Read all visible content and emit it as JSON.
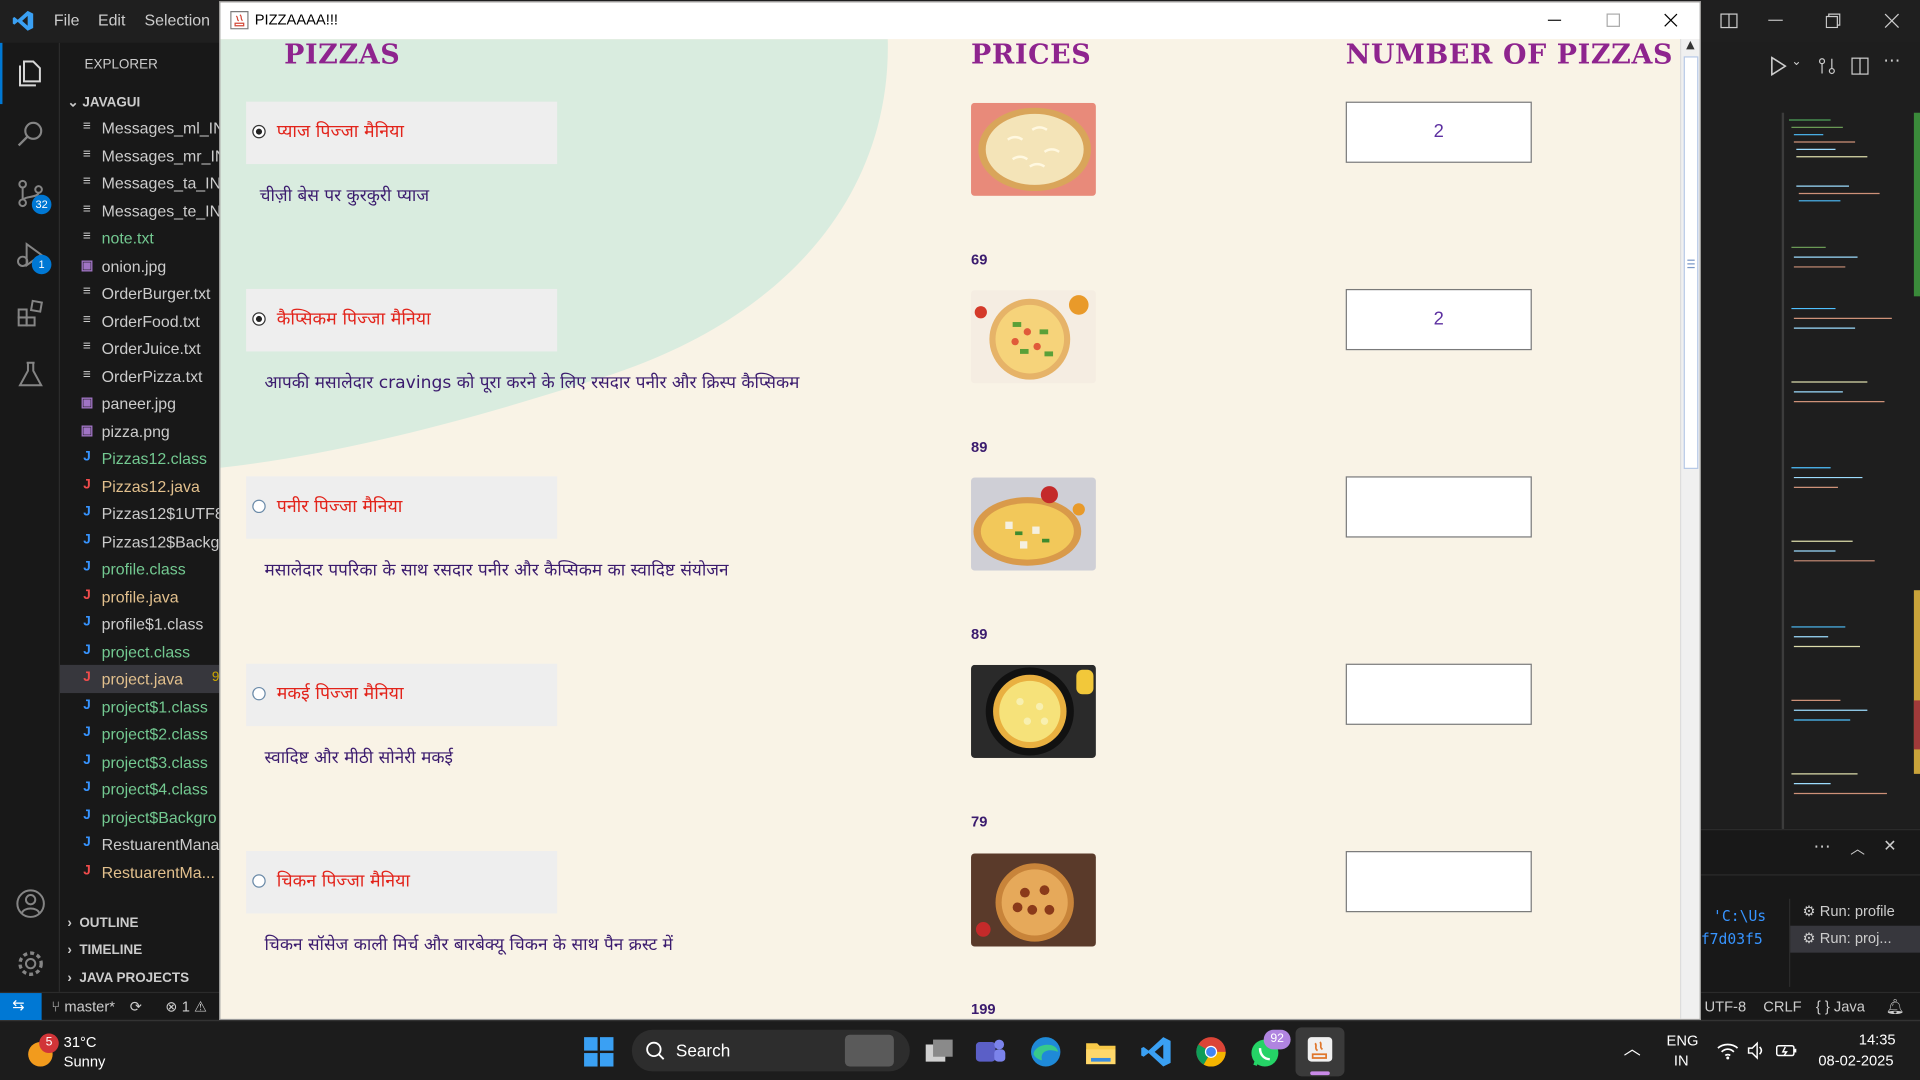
{
  "vscode": {
    "menu": [
      "File",
      "Edit",
      "Selection"
    ],
    "explorer_label": "EXPLORER",
    "folder_label": "JAVAGUI",
    "badges": {
      "source_control": "32",
      "run_debug": "1"
    },
    "files": [
      {
        "name": "Messages_ml_IN",
        "icon": "≡",
        "color": "#cccccc",
        "icon_color": "#cccccc"
      },
      {
        "name": "Messages_mr_IN",
        "icon": "≡",
        "color": "#cccccc",
        "icon_color": "#cccccc"
      },
      {
        "name": "Messages_ta_IN.",
        "icon": "≡",
        "color": "#cccccc",
        "icon_color": "#cccccc"
      },
      {
        "name": "Messages_te_IN.",
        "icon": "≡",
        "color": "#cccccc",
        "icon_color": "#cccccc"
      },
      {
        "name": "note.txt",
        "icon": "≡",
        "color": "#73c991",
        "icon_color": "#cccccc"
      },
      {
        "name": "onion.jpg",
        "icon": "▣",
        "color": "#cccccc",
        "icon_color": "#a074c4"
      },
      {
        "name": "OrderBurger.txt",
        "icon": "≡",
        "color": "#cccccc",
        "icon_color": "#cccccc"
      },
      {
        "name": "OrderFood.txt",
        "icon": "≡",
        "color": "#cccccc",
        "icon_color": "#cccccc"
      },
      {
        "name": "OrderJuice.txt",
        "icon": "≡",
        "color": "#cccccc",
        "icon_color": "#cccccc"
      },
      {
        "name": "OrderPizza.txt",
        "icon": "≡",
        "color": "#cccccc",
        "icon_color": "#cccccc"
      },
      {
        "name": "paneer.jpg",
        "icon": "▣",
        "color": "#cccccc",
        "icon_color": "#a074c4"
      },
      {
        "name": "pizza.png",
        "icon": "▣",
        "color": "#cccccc",
        "icon_color": "#a074c4"
      },
      {
        "name": "Pizzas12.class",
        "icon": "J",
        "color": "#73c991",
        "icon_color": "#3794ff"
      },
      {
        "name": "Pizzas12.java",
        "icon": "J",
        "color": "#e2c08d",
        "icon_color": "#f14c4c"
      },
      {
        "name": "Pizzas12$1UTF8",
        "icon": "J",
        "color": "#cccccc",
        "icon_color": "#3794ff"
      },
      {
        "name": "Pizzas12$Backgr",
        "icon": "J",
        "color": "#cccccc",
        "icon_color": "#3794ff"
      },
      {
        "name": "profile.class",
        "icon": "J",
        "color": "#73c991",
        "icon_color": "#3794ff"
      },
      {
        "name": "profile.java",
        "icon": "J",
        "color": "#e2c08d",
        "icon_color": "#f14c4c"
      },
      {
        "name": "profile$1.class",
        "icon": "J",
        "color": "#cccccc",
        "icon_color": "#3794ff"
      },
      {
        "name": "project.class",
        "icon": "J",
        "color": "#73c991",
        "icon_color": "#3794ff"
      },
      {
        "name": "project.java",
        "icon": "J",
        "color": "#e2c08d",
        "icon_color": "#f14c4c",
        "selected": true,
        "extra": "9"
      },
      {
        "name": "project$1.class",
        "icon": "J",
        "color": "#73c991",
        "icon_color": "#3794ff"
      },
      {
        "name": "project$2.class",
        "icon": "J",
        "color": "#73c991",
        "icon_color": "#3794ff"
      },
      {
        "name": "project$3.class",
        "icon": "J",
        "color": "#73c991",
        "icon_color": "#3794ff"
      },
      {
        "name": "project$4.class",
        "icon": "J",
        "color": "#73c991",
        "icon_color": "#3794ff"
      },
      {
        "name": "project$Backgro",
        "icon": "J",
        "color": "#73c991",
        "icon_color": "#3794ff"
      },
      {
        "name": "RestuarentMana",
        "icon": "J",
        "color": "#cccccc",
        "icon_color": "#3794ff"
      },
      {
        "name": "RestuarentMa...",
        "icon": "J",
        "color": "#e2c08d",
        "icon_color": "#f14c4c"
      }
    ],
    "sections": [
      "OUTLINE",
      "TIMELINE",
      "JAVA PROJECTS"
    ],
    "terminal_snippets": [
      "'C:\\Us",
      "f7d03f5"
    ],
    "run_items": [
      "Run: profile",
      "Run: proj..."
    ],
    "status_left": {
      "branch": "master*",
      "errors": "1"
    },
    "status_right": [
      "UTF-8",
      "CRLF",
      "{ } Java"
    ]
  },
  "java_window": {
    "title": "PIZZAAAA!!!",
    "headers": {
      "pizzas": "PIZZAS",
      "prices": "PRICES",
      "number": "NUMBER OF PIZZAS"
    },
    "items": [
      {
        "name": "प्याज पिज्जा मैनिया",
        "desc": "चीज़ी बेस पर कुरकुरी प्याज",
        "price": "69",
        "qty": "2",
        "selected": true
      },
      {
        "name": "कैप्सिकम पिज्जा मैनिया",
        "desc": "आपकी मसालेदार cravings को पूरा करने के लिए रसदार पनीर और क्रिस्प कैप्सिकम",
        "price": "89",
        "qty": "2",
        "selected": true
      },
      {
        "name": "पनीर पिज्जा मैनिया",
        "desc": "मसालेदार पपरिका के साथ रसदार पनीर और कैप्सिकम का स्वादिष्ट संयोजन",
        "price": "89",
        "qty": "",
        "selected": false
      },
      {
        "name": "मकई पिज्जा मैनिया",
        "desc": "स्वादिष्ट और मीठी सोनेरी मकई",
        "price": "79",
        "qty": "",
        "selected": false
      },
      {
        "name": "चिकन पिज्जा मैनिया",
        "desc": "चिकन सॉसेज काली मिर्च और बारबेक्यू चिकन के साथ पैन क्रस्ट में",
        "price": "199",
        "qty": "",
        "selected": false
      }
    ]
  },
  "taskbar": {
    "weather": {
      "temp": "31°C",
      "condition": "Sunny",
      "badge": "5"
    },
    "search_label": "Search",
    "whatsapp_badge": "92",
    "lang": [
      "ENG",
      "IN"
    ],
    "time": "14:35",
    "date": "08-02-2025"
  }
}
